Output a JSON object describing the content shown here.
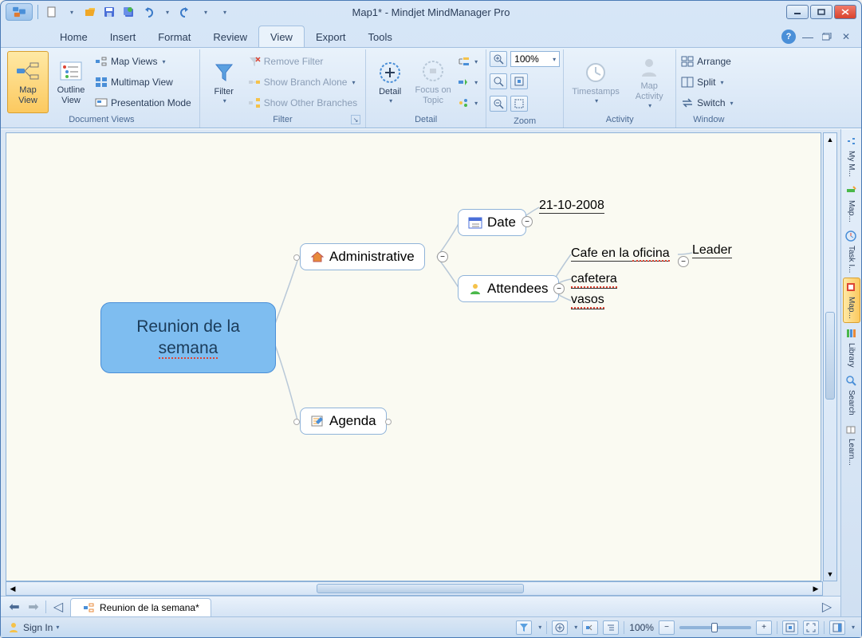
{
  "window": {
    "title": "Map1* - Mindjet MindManager Pro"
  },
  "qat": {
    "items": [
      "new",
      "open",
      "save",
      "save-as",
      "undo",
      "redo"
    ]
  },
  "tabs": {
    "items": [
      "Home",
      "Insert",
      "Format",
      "Review",
      "View",
      "Export",
      "Tools"
    ],
    "active": "View"
  },
  "ribbon": {
    "groups": {
      "document_views": {
        "label": "Document Views",
        "map_view": "Map View",
        "outline_view": "Outline View",
        "map_views": "Map Views",
        "multimap": "Multimap View",
        "presentation": "Presentation Mode"
      },
      "filter": {
        "label": "Filter",
        "filter": "Filter",
        "remove": "Remove Filter",
        "branch_alone": "Show Branch Alone",
        "other_branches": "Show Other Branches"
      },
      "detail": {
        "label": "Detail",
        "detail": "Detail",
        "focus": "Focus on Topic"
      },
      "zoom": {
        "label": "Zoom",
        "value": "100%"
      },
      "activity": {
        "label": "Activity",
        "timestamps": "Timestamps",
        "map_activity": "Map Activity"
      },
      "window_grp": {
        "label": "Window",
        "arrange": "Arrange",
        "split": "Split",
        "switch": "Switch"
      }
    }
  },
  "map": {
    "root": "Reunion de la semana",
    "admin": "Administrative",
    "agenda": "Agenda",
    "date": "Date",
    "date_value": "21-10-2008",
    "attendees": "Attendees",
    "cafe": "Cafe en la oficina",
    "leader": "Leader",
    "cafetera": "cafetera",
    "vasos": "vasos"
  },
  "sidetabs": [
    "My M...",
    "Map...",
    "Task I...",
    "Map...",
    "Library",
    "Search",
    "Learn..."
  ],
  "doctab": {
    "name": "Reunion de la semana*"
  },
  "status": {
    "signin": "Sign In",
    "zoom": "100%"
  }
}
